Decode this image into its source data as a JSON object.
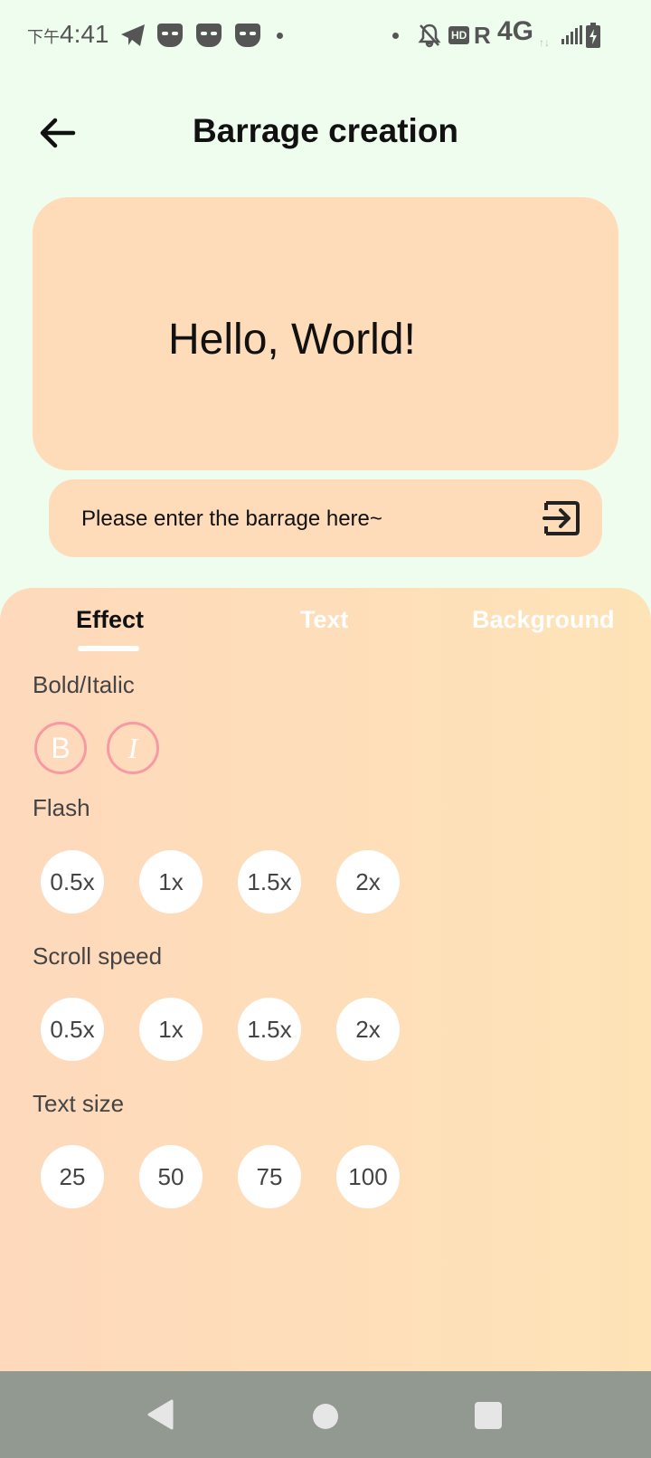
{
  "status_bar": {
    "time_prefix": "下午",
    "time": "4:41",
    "hd": "HD",
    "roaming": "R",
    "network": "4G"
  },
  "header": {
    "title": "Barrage creation",
    "back_icon": "arrow-left-icon"
  },
  "preview": {
    "text": "Hello, World!",
    "background": "#fedcba"
  },
  "input": {
    "placeholder": "Please enter the barrage here~",
    "send_icon": "exit-to-app-icon"
  },
  "tabs": [
    {
      "label": "Effect",
      "selected": true
    },
    {
      "label": "Text",
      "selected": false
    },
    {
      "label": "Background",
      "selected": false
    }
  ],
  "effect": {
    "bold_italic": {
      "label": "Bold/Italic",
      "bold": "B",
      "italic": "I"
    },
    "flash": {
      "label": "Flash",
      "options": [
        "0.5x",
        "1x",
        "1.5x",
        "2x"
      ]
    },
    "scroll_speed": {
      "label": "Scroll speed",
      "options": [
        "0.5x",
        "1x",
        "1.5x",
        "2x"
      ]
    },
    "text_size": {
      "label": "Text size",
      "options": [
        "25",
        "50",
        "75",
        "100"
      ]
    }
  },
  "colors": {
    "accent_pink": "#f79aa3",
    "panel_gradient_start": "#fed9bc",
    "panel_gradient_end": "#fee3b7",
    "page_background": "#effdee"
  }
}
